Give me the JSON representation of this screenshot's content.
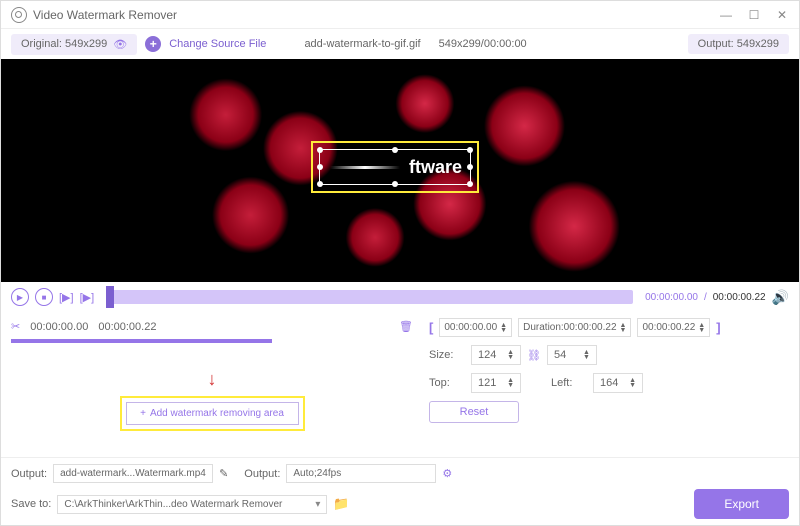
{
  "app": {
    "title": "Video Watermark Remover"
  },
  "infobar": {
    "original": "Original: 549x299",
    "change_source": "Change Source File",
    "filename": "add-watermark-to-gif.gif",
    "dims_time": "549x299/00:00:00",
    "output": "Output: 549x299"
  },
  "selection": {
    "text": "ftware"
  },
  "playback": {
    "current": "00:00:00.00",
    "total": "00:00:00.22"
  },
  "segment": {
    "start": "00:00:00.00",
    "end": "00:00:00.22"
  },
  "add_area": {
    "label": "Add watermark removing area"
  },
  "duration": {
    "start": "00:00:00.00",
    "label": "Duration:00:00:00.22",
    "end": "00:00:00.22"
  },
  "size": {
    "label": "Size:",
    "width": "124",
    "height": "54"
  },
  "position": {
    "top_label": "Top:",
    "top": "121",
    "left_label": "Left:",
    "left": "164"
  },
  "reset": "Reset",
  "output_row": {
    "label1": "Output:",
    "filename": "add-watermark...Watermark.mp4",
    "label2": "Output:",
    "format": "Auto;24fps"
  },
  "save_row": {
    "label": "Save to:",
    "path": "C:\\ArkThinker\\ArkThin...deo Watermark Remover"
  },
  "export": "Export"
}
